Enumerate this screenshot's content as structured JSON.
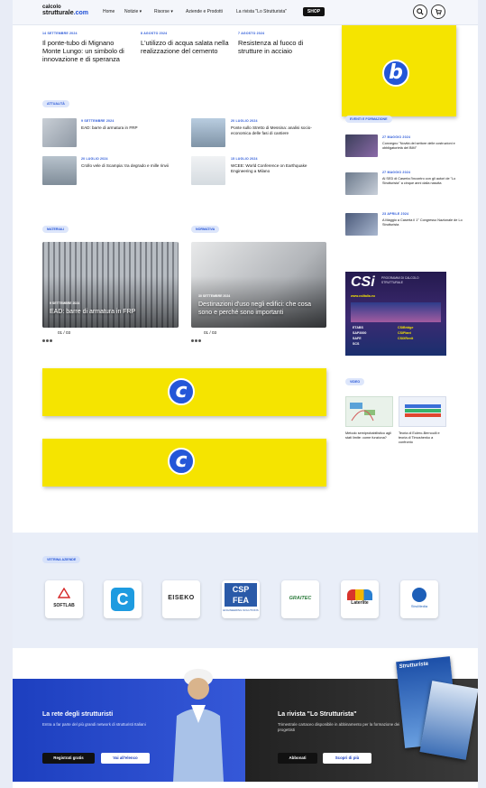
{
  "header": {
    "logo_line1": "calcolo",
    "logo_line2a": "strutturale",
    "logo_line2b": ".com",
    "nav": [
      "Home",
      "Notizie ▾",
      "Risorse ▾",
      "Aziende e Prodotti",
      "La rivista \"Lo Strutturista\""
    ],
    "shop": "SHOP",
    "search_icon": "search-icon",
    "cart_icon": "cart-icon"
  },
  "top_articles": [
    {
      "date": "14 SETTEMBRE 2024",
      "title": "Il ponte-tubo di Mignano Monte Lungo: un simbolo di innovazione e di speranza"
    },
    {
      "date": "8 AGOSTO 2024",
      "title": "L'utilizzo di acqua salata nella realizzazione del cemento"
    },
    {
      "date": "7 AGOSTO 2024",
      "title": "Resistenza al fuoco di strutture in acciaio"
    }
  ],
  "badges": {
    "b": "b",
    "c": "c"
  },
  "attualita": {
    "label": "ATTUALITÀ",
    "items": [
      {
        "date": "9 SETTEMBRE 2024",
        "title": "EAD: barre di armatura in FRP"
      },
      {
        "date": "20 LUGLIO 2024",
        "title": "Ponte sullo Stretto di Messina: analisi socio-economica delle fasi di cantiere"
      },
      {
        "date": "20 LUGLIO 2024",
        "title": "Crollo vele di Scampia: tra degrado e mille rinvii"
      },
      {
        "date": "15 LUGLIO 2024",
        "title": "WCEE: World Conference on Earthquake Engineering a Milano"
      }
    ]
  },
  "eventi": {
    "label": "EVENTI E FORMAZIONE",
    "items": [
      {
        "date": "27 MAGGIO 2024",
        "title": "Convegno \"Novità del settore delle costruzioni e obbligatorietà del BIM\""
      },
      {
        "date": "27 MAGGIO 2024",
        "title": "Al SED di Caserta l'incontro con gli autori de \"Lo Strutturista\" a cinque anni dalla nascita"
      },
      {
        "date": "23 APRILE 2024",
        "title": "A Maggio a Caserta il 1° Congresso Nazionale de Lo Strutturista"
      }
    ]
  },
  "materiali": {
    "label": "MATERIALI",
    "date": "9 SETTEMBRE 2024",
    "caption": "EAD: barre di armatura in FRP",
    "pager": "01 / 03"
  },
  "normativa": {
    "label": "NORMATIVA",
    "date": "30 SETTEMBRE 2024",
    "caption": "Destinazioni d'uso negli edifici: che cosa sono e perché sono importanti",
    "pager": "01 / 03"
  },
  "csi_ad": {
    "logo": "CSi",
    "line1": "PROGRAMMI DI CALCOLO",
    "line2": "STRUTTURALE",
    "site": "www.csiitalia.eu",
    "products": [
      "ETABS",
      "SAP2000",
      "SAFE",
      "SCS",
      "CSiBridge",
      "CSiPlant",
      "CSiXRevit"
    ]
  },
  "video": {
    "label": "VIDEO",
    "items": [
      {
        "title": "Metodo semiprobabilistico agli stati limite: come funziona?"
      },
      {
        "title": "Teoria di Eulero-Bernoulli e teoria di Timoshenko a confronto"
      }
    ]
  },
  "vetrina": {
    "label": "VETRINA AZIENDE",
    "logos": [
      {
        "name": "SOFTLAB",
        "color": "#d62a2a"
      },
      {
        "name": "C",
        "color": "#1e9be0"
      },
      {
        "name": "EISEKO",
        "color": "#222222"
      },
      {
        "name": "CSP FEA",
        "color": "#2a5aa8"
      },
      {
        "name": "GRAITEC",
        "color": "#2a7a3a"
      },
      {
        "name": "Laterlite",
        "color": "#d9342b"
      },
      {
        "name": "StruMedia",
        "color": "#1d5fb8"
      }
    ],
    "logo_texts": {
      "csp_sub": "ENGINEERING SOLUTIONS"
    }
  },
  "footer_left": {
    "title": "La rete degli strutturisti",
    "text": "Entra a far parte del più grandi network di strutturisti Italiani",
    "btn1": "Registrati gratis",
    "btn2": "Vai all'elenco"
  },
  "footer_right": {
    "title": "La rivista \"Lo Strutturista\"",
    "text": "Trimestrale cartaceo disponibile in abbinamento per la formazione dei progettisti",
    "btn1": "Abbonati",
    "btn2": "Scopri di più",
    "magazine": "Strutturista"
  },
  "colors": {
    "accent": "#2457d8",
    "yellow": "#f5e400",
    "footer_blue": "#1d3fbf",
    "footer_dark": "#2b2b2b"
  }
}
